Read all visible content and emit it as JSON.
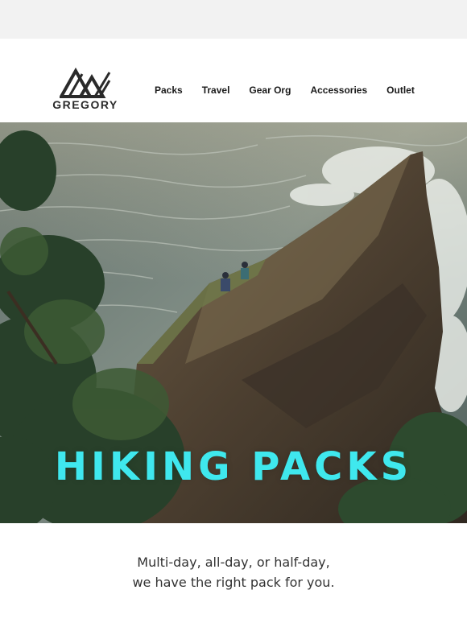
{
  "brand": {
    "name": "GREGORY",
    "accent_color": "#3fe8ee"
  },
  "nav": {
    "items": [
      {
        "label": "Packs"
      },
      {
        "label": "Travel"
      },
      {
        "label": "Gear Org"
      },
      {
        "label": "Accessories"
      },
      {
        "label": "Outlet"
      }
    ]
  },
  "hero": {
    "headline": "HIKING PACKS",
    "image": "coastal-cliff-hikers-photo"
  },
  "body": {
    "tagline_line1": "Multi-day, all-day, or half-day,",
    "tagline_line2": "we have the right pack for you."
  }
}
